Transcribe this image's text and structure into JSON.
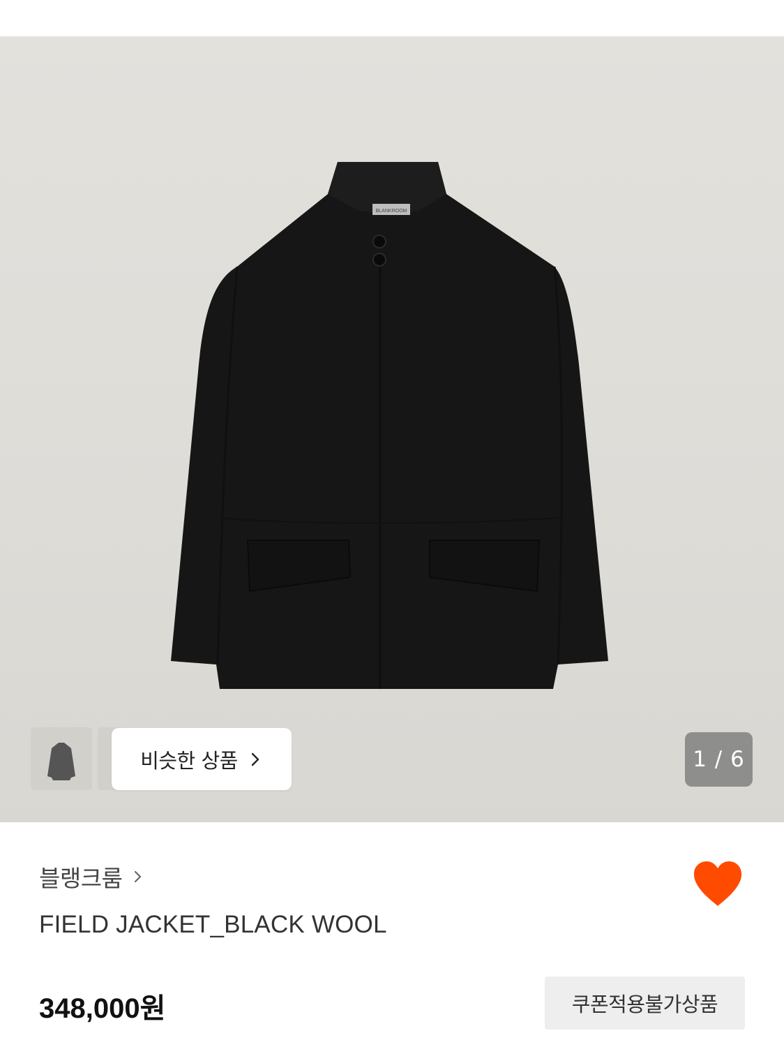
{
  "gallery": {
    "similar_label": "비슷한 상품",
    "counter": "1 / 6",
    "logo_text": "BLANKROOM"
  },
  "product": {
    "brand": "블랭크룸",
    "name": "FIELD JACKET_BLACK WOOL",
    "price": "348,000원",
    "coupon_badge": "쿠폰적용불가상품",
    "liked": true
  },
  "colors": {
    "heart": "#ff4b00",
    "hero_bg": "#dfddd8",
    "jacket": "#161616"
  }
}
